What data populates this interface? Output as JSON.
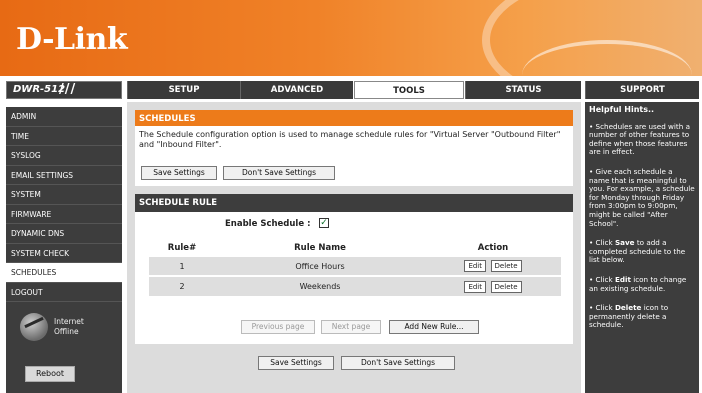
{
  "brand": {
    "logo": "D-Link"
  },
  "nav": {
    "model": "DWR-512",
    "model_bars": "///",
    "tabs": [
      "SETUP",
      "ADVANCED",
      "TOOLS",
      "STATUS",
      "SUPPORT"
    ],
    "active_tab": "TOOLS"
  },
  "sidebar": {
    "items": [
      "ADMIN",
      "TIME",
      "SYSLOG",
      "EMAIL SETTINGS",
      "SYSTEM",
      "FIRMWARE",
      "DYNAMIC DNS",
      "SYSTEM CHECK",
      "SCHEDULES",
      "LOGOUT"
    ],
    "active": "SCHEDULES",
    "internet_status": [
      "Internet",
      "Offline"
    ],
    "reboot_label": "Reboot"
  },
  "schedules": {
    "title": "SCHEDULES",
    "description": "The Schedule configuration option is used to manage schedule rules for \"Virtual Server \"Outbound Filter\" and \"Inbound Filter\".",
    "save_label": "Save Settings",
    "dont_save_label": "Don't Save Settings"
  },
  "schedule_rule": {
    "title": "SCHEDULE RULE",
    "enable_label": "Enable Schedule :",
    "enable_checked": "✓",
    "columns": [
      "Rule#",
      "Rule Name",
      "Action"
    ],
    "rows": [
      {
        "num": "1",
        "name": "Office Hours",
        "edit": "Edit",
        "delete": "Delete"
      },
      {
        "num": "2",
        "name": "Weekends",
        "edit": "Edit",
        "delete": "Delete"
      }
    ],
    "prev_label": "Previous page",
    "next_label": "Next page",
    "add_label": "Add New Rule..."
  },
  "bottom": {
    "save_label": "Save Settings",
    "dont_save_label": "Don't Save Settings"
  },
  "hints": {
    "title": "Helpful Hints..",
    "h1": "• Schedules are used with a number of other features to define when those features are in effect.",
    "h2": "• Give each schedule a name that is meaningful to you. For example, a schedule for Monday through Friday from 3:00pm to 9:00pm, might be called \"After School\".",
    "h3_pre": "• Click ",
    "h3_bold": "Save",
    "h3_post": " to add a completed schedule to the list below.",
    "h4_pre": "• Click ",
    "h4_bold": "Edit",
    "h4_post": " icon to change an existing schedule.",
    "h5_pre": "• Click ",
    "h5_bold": "Delete",
    "h5_post": " icon to permanently delete a schedule."
  }
}
